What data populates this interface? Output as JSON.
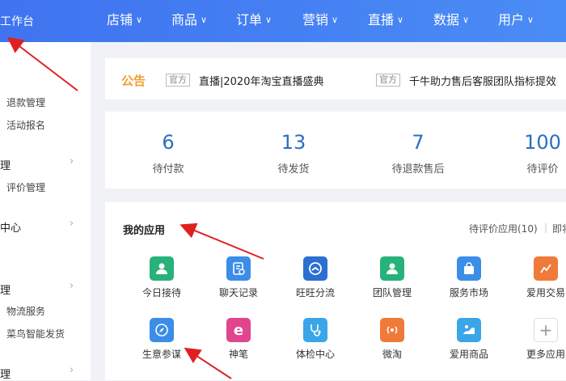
{
  "topbar": {
    "brand": "工作台",
    "nav": [
      "店铺",
      "商品",
      "订单",
      "营销",
      "直播",
      "数据",
      "用户"
    ]
  },
  "sidebar": {
    "items": [
      {
        "text": "退款管理"
      },
      {
        "text": "活动报名"
      },
      {
        "text": "理"
      },
      {
        "text": "评价管理"
      },
      {
        "text": "中心"
      },
      {
        "text": "理"
      },
      {
        "text": "物流服务"
      },
      {
        "text": "菜鸟智能发货"
      },
      {
        "text": "理"
      }
    ]
  },
  "notice": {
    "label": "公告",
    "items": [
      {
        "tag": "官方",
        "text": "直播|2020年淘宝直播盛典"
      },
      {
        "tag": "官方",
        "text": "千牛助力售后客服团队指标提效"
      }
    ]
  },
  "stats": [
    {
      "value": "6",
      "label": "待付款"
    },
    {
      "value": "13",
      "label": "待发货"
    },
    {
      "value": "7",
      "label": "待退款售后"
    },
    {
      "value": "100",
      "label": "待评价"
    }
  ],
  "apps": {
    "title": "我的应用",
    "link1": "待评价应用(10)",
    "link2": "即将",
    "items": [
      {
        "label": "今日接待",
        "icon": "person-icon",
        "color": "#27b27a"
      },
      {
        "label": "聊天记录",
        "icon": "chat-record-icon",
        "color": "#3b8de8"
      },
      {
        "label": "旺旺分流",
        "icon": "split-icon",
        "color": "#2b6fd0"
      },
      {
        "label": "团队管理",
        "icon": "team-icon",
        "color": "#27b27a"
      },
      {
        "label": "服务市场",
        "icon": "shop-bag-icon",
        "color": "#3b8de8"
      },
      {
        "label": "爱用交易",
        "icon": "trade-icon",
        "color": "#f07a3a"
      },
      {
        "label": "生意参谋",
        "icon": "compass-icon",
        "color": "#3b8de8"
      },
      {
        "label": "神笔",
        "icon": "pen-icon",
        "color": "#e0458e"
      },
      {
        "label": "体检中心",
        "icon": "stethoscope-icon",
        "color": "#3aa6e8"
      },
      {
        "label": "微淘",
        "icon": "broadcast-icon",
        "color": "#f07a3a"
      },
      {
        "label": "爱用商品",
        "icon": "goods-icon",
        "color": "#3aa6e8"
      },
      {
        "label": "更多应用",
        "icon": "plus-icon",
        "color": "#ffffff"
      }
    ]
  }
}
